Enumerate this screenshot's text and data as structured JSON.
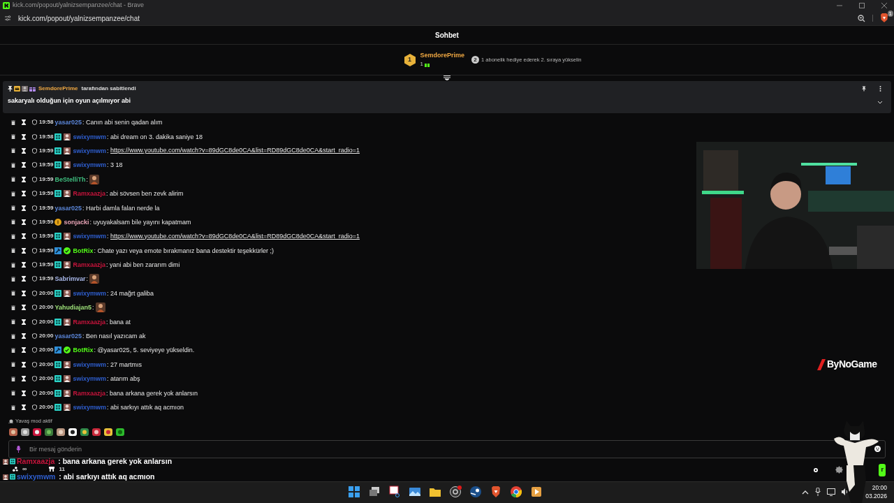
{
  "browser": {
    "window_title": "kick.com/popout/yalnizsempanzee/chat - Brave",
    "address": "kick.com/popout/yalnizsempanzee/chat",
    "shields_count": "1"
  },
  "chat": {
    "title": "Sohbet",
    "leaderboard": {
      "rank": "1",
      "user": "SemdorePrime",
      "gifts": "1",
      "next_rank": "2",
      "hint": "1 abonelik hediye ederek 2. sıraya yükselin"
    },
    "pinned": {
      "user": "SemdorePrime",
      "suffix": "tarafından sabitlendi",
      "text": "sakaryalı olduğun için oyun açılmıyor abi",
      "expanded": false
    },
    "messages": [
      {
        "time": "19:58",
        "user": "yasar025",
        "color": "#5b86d9",
        "kind": "text",
        "text": ": Canın abi senin qadan alım"
      },
      {
        "time": "19:58",
        "user": "swixymwm",
        "color": "#2f5fd0",
        "sub_badge": true,
        "avatar_badge": true,
        "kind": "text",
        "text": ": abi dream on 3. dakika saniye 18"
      },
      {
        "time": "19:59",
        "user": "swixymwm",
        "color": "#2f5fd0",
        "sub_badge": true,
        "avatar_badge": true,
        "kind": "link",
        "text": ": ",
        "link": "https://www.youtube.com/watch?v=89dGC8de0CA&list=RD89dGC8de0CA&start_radio=1"
      },
      {
        "time": "19:59",
        "user": "swixymwm",
        "color": "#2f5fd0",
        "sub_badge": true,
        "avatar_badge": true,
        "kind": "text",
        "text": ": 3 18"
      },
      {
        "time": "19:59",
        "user": "BeStelliTh",
        "color": "#3fbf7f",
        "kind": "emote",
        "text": ":"
      },
      {
        "time": "19:59",
        "user": "Ramxaazja",
        "color": "#c8143c",
        "sub_badge": true,
        "avatar_badge": true,
        "kind": "text",
        "text": ": abi sövsen ben zevk alirim"
      },
      {
        "time": "19:59",
        "user": "yasar025",
        "color": "#5b86d9",
        "kind": "text",
        "text": ": Harbi damla falan nerde la"
      },
      {
        "time": "19:59",
        "user": "sonjacki",
        "color": "#e7a3b5",
        "coin_badge": true,
        "kind": "text",
        "text": ": uyuyakalsam bile yayını kapatmam"
      },
      {
        "time": "19:59",
        "user": "swixymwm",
        "color": "#2f5fd0",
        "sub_badge": true,
        "avatar_badge": true,
        "kind": "link",
        "text": ": ",
        "link": "https://www.youtube.com/watch?v=89dGC8de0CA&list=RD89dGC8de0CA&start_radio=1"
      },
      {
        "time": "19:59",
        "user": "BotRix",
        "color": "#53fc18",
        "bot_badge": true,
        "verified": true,
        "kind": "text",
        "text": ": Chate yazı veya emote bırakmanız bana destektir teşekkürler ;)"
      },
      {
        "time": "19:59",
        "user": "Ramxaazja",
        "color": "#c8143c",
        "sub_badge": true,
        "avatar_badge": true,
        "kind": "text",
        "text": ": yani abi ben zararım dimi"
      },
      {
        "time": "19:59",
        "user": "Sabrimvar",
        "color": "#a9b8ea",
        "kind": "emote",
        "text": ":"
      },
      {
        "time": "20:00",
        "user": "swixymwm",
        "color": "#2f5fd0",
        "sub_badge": true,
        "avatar_badge": true,
        "kind": "text",
        "text": ": 24 mağrt galiba"
      },
      {
        "time": "20:00",
        "user": "Yahudiajan5",
        "color": "#9fe37a",
        "kind": "emote",
        "text": ":"
      },
      {
        "time": "20:00",
        "user": "Ramxaazja",
        "color": "#c8143c",
        "sub_badge": true,
        "avatar_badge": true,
        "kind": "text",
        "text": ": bana at"
      },
      {
        "time": "20:00",
        "user": "yasar025",
        "color": "#5b86d9",
        "kind": "text",
        "text": ": Ben nasıl yazıcam ak"
      },
      {
        "time": "20:00",
        "user": "BotRix",
        "color": "#53fc18",
        "bot_badge": true,
        "verified": true,
        "kind": "text",
        "text": ": @yasar025, 5. seviyeye yükseldin."
      },
      {
        "time": "20:00",
        "user": "swixymwm",
        "color": "#2f5fd0",
        "sub_badge": true,
        "avatar_badge": true,
        "kind": "text",
        "text": ": 27 martmıs"
      },
      {
        "time": "20:00",
        "user": "swixymwm",
        "color": "#2f5fd0",
        "sub_badge": true,
        "avatar_badge": true,
        "kind": "text",
        "text": ": atarım abş"
      },
      {
        "time": "20:00",
        "user": "Ramxaazja",
        "color": "#c8143c",
        "sub_badge": true,
        "avatar_badge": true,
        "kind": "text",
        "text": ": bana arkana gerek yok anlarsın"
      },
      {
        "time": "20:00",
        "user": "swixymwm",
        "color": "#2f5fd0",
        "sub_badge": true,
        "avatar_badge": true,
        "kind": "text",
        "text": ": abi sarkıyı attık aq acmıon"
      }
    ],
    "slow_mode": "Yavaş mod aktif",
    "input": {
      "placeholder": "Bir mesaj gönderin"
    },
    "footer": {
      "points": "∞",
      "store_count": "11",
      "send_label": "r"
    }
  },
  "overlay_chat": [
    {
      "user": "Ramxaazja",
      "color": "#c8143c",
      "text": " : bana arkana gerek yok anlarsın"
    },
    {
      "user": "swixymwm",
      "color": "#2f5fd0",
      "text": " : abi sarkıyı attık aq acmıon"
    }
  ],
  "stream_logo": "ByNoGame",
  "taskbar": {
    "time": "20:00",
    "date": "03.2026"
  }
}
